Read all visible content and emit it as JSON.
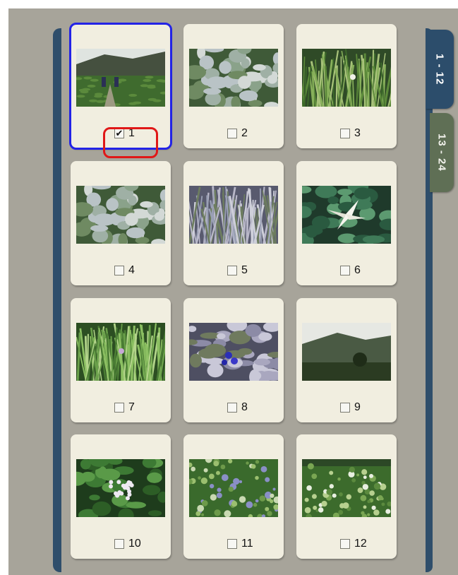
{
  "tabs": [
    {
      "label": "1 - 12",
      "active": true
    },
    {
      "label": "13 - 24",
      "active": false
    }
  ],
  "thumbnails": [
    {
      "number": "1",
      "checked": true,
      "selected": true,
      "scene": "mountain-tea-field"
    },
    {
      "number": "2",
      "checked": false,
      "selected": false,
      "scene": "leafy-plants"
    },
    {
      "number": "3",
      "checked": false,
      "selected": false,
      "scene": "grass"
    },
    {
      "number": "4",
      "checked": false,
      "selected": false,
      "scene": "leafy-plants"
    },
    {
      "number": "5",
      "checked": false,
      "selected": false,
      "scene": "grass-purple"
    },
    {
      "number": "6",
      "checked": false,
      "selected": false,
      "scene": "white-lily"
    },
    {
      "number": "7",
      "checked": false,
      "selected": false,
      "scene": "tall-grass"
    },
    {
      "number": "8",
      "checked": false,
      "selected": false,
      "scene": "blue-flower"
    },
    {
      "number": "9",
      "checked": false,
      "selected": false,
      "scene": "misty-mountain"
    },
    {
      "number": "10",
      "checked": false,
      "selected": false,
      "scene": "white-blossom"
    },
    {
      "number": "11",
      "checked": false,
      "selected": false,
      "scene": "meadow"
    },
    {
      "number": "12",
      "checked": false,
      "selected": false,
      "scene": "meadow-flowers"
    }
  ],
  "colors": {
    "background": "#a7a49a",
    "card": "#f1eee0",
    "rail": "#2f4e6b",
    "active_tab": "#2c4d6b",
    "inactive_tab": "#5f6f55",
    "selection_border": "#2323e6",
    "highlight": "#e01818"
  },
  "icons": {
    "checked": "checkbox-checked-icon",
    "unchecked": "checkbox-empty-icon"
  }
}
